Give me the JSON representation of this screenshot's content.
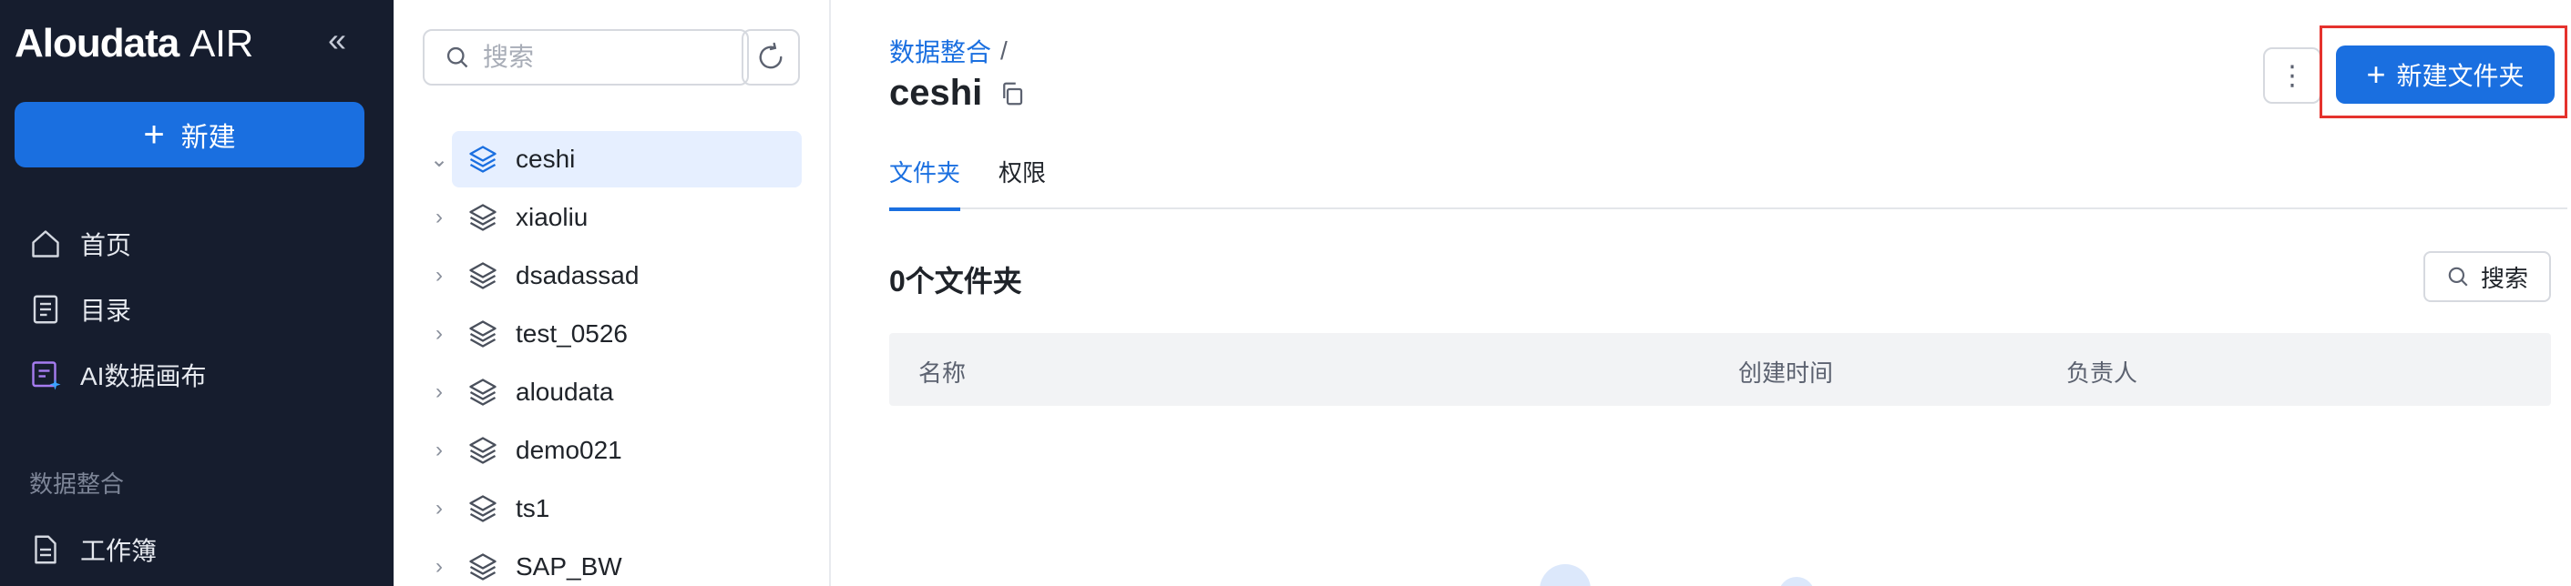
{
  "colors": {
    "sidebar_bg": "#161d2e",
    "accent": "#1a6fe0",
    "highlight": "#e5322d",
    "active_row_bg": "#e6efff",
    "table_header_bg": "#f2f3f5"
  },
  "app": {
    "logo_brand": "Aloudata",
    "logo_suffix": "AIR",
    "collapse_icon": "collapse-double-chevron-left-icon"
  },
  "sidebar": {
    "new_button_label": "新建",
    "items": [
      {
        "label": "首页",
        "icon": "home-icon"
      },
      {
        "label": "目录",
        "icon": "catalog-icon"
      },
      {
        "label": "AI数据画布",
        "icon": "ai-canvas-icon"
      }
    ],
    "section_title": "数据整合",
    "section_items": [
      {
        "label": "工作簿",
        "icon": "workbook-icon"
      }
    ]
  },
  "tree": {
    "search_placeholder": "搜索",
    "items": [
      {
        "label": "ceshi",
        "expanded": true,
        "selected": true
      },
      {
        "label": "xiaoliu",
        "expanded": false,
        "selected": false
      },
      {
        "label": "dsadassad",
        "expanded": false,
        "selected": false
      },
      {
        "label": "test_0526",
        "expanded": false,
        "selected": false
      },
      {
        "label": "aloudata",
        "expanded": false,
        "selected": false
      },
      {
        "label": "demo021",
        "expanded": false,
        "selected": false
      },
      {
        "label": "ts1",
        "expanded": false,
        "selected": false
      },
      {
        "label": "SAP_BW",
        "expanded": false,
        "selected": false
      }
    ]
  },
  "main": {
    "breadcrumb": {
      "link": "数据整合",
      "separator": "/"
    },
    "title": "ceshi",
    "more_label": "⋮",
    "new_folder_label": "新建文件夹",
    "tabs": [
      {
        "label": "文件夹",
        "active": true
      },
      {
        "label": "权限",
        "active": false
      }
    ],
    "folder_count_label": "0个文件夹",
    "search_button_label": "搜索",
    "table": {
      "columns": [
        "名称",
        "创建时间",
        "负责人"
      ],
      "rows": []
    }
  }
}
